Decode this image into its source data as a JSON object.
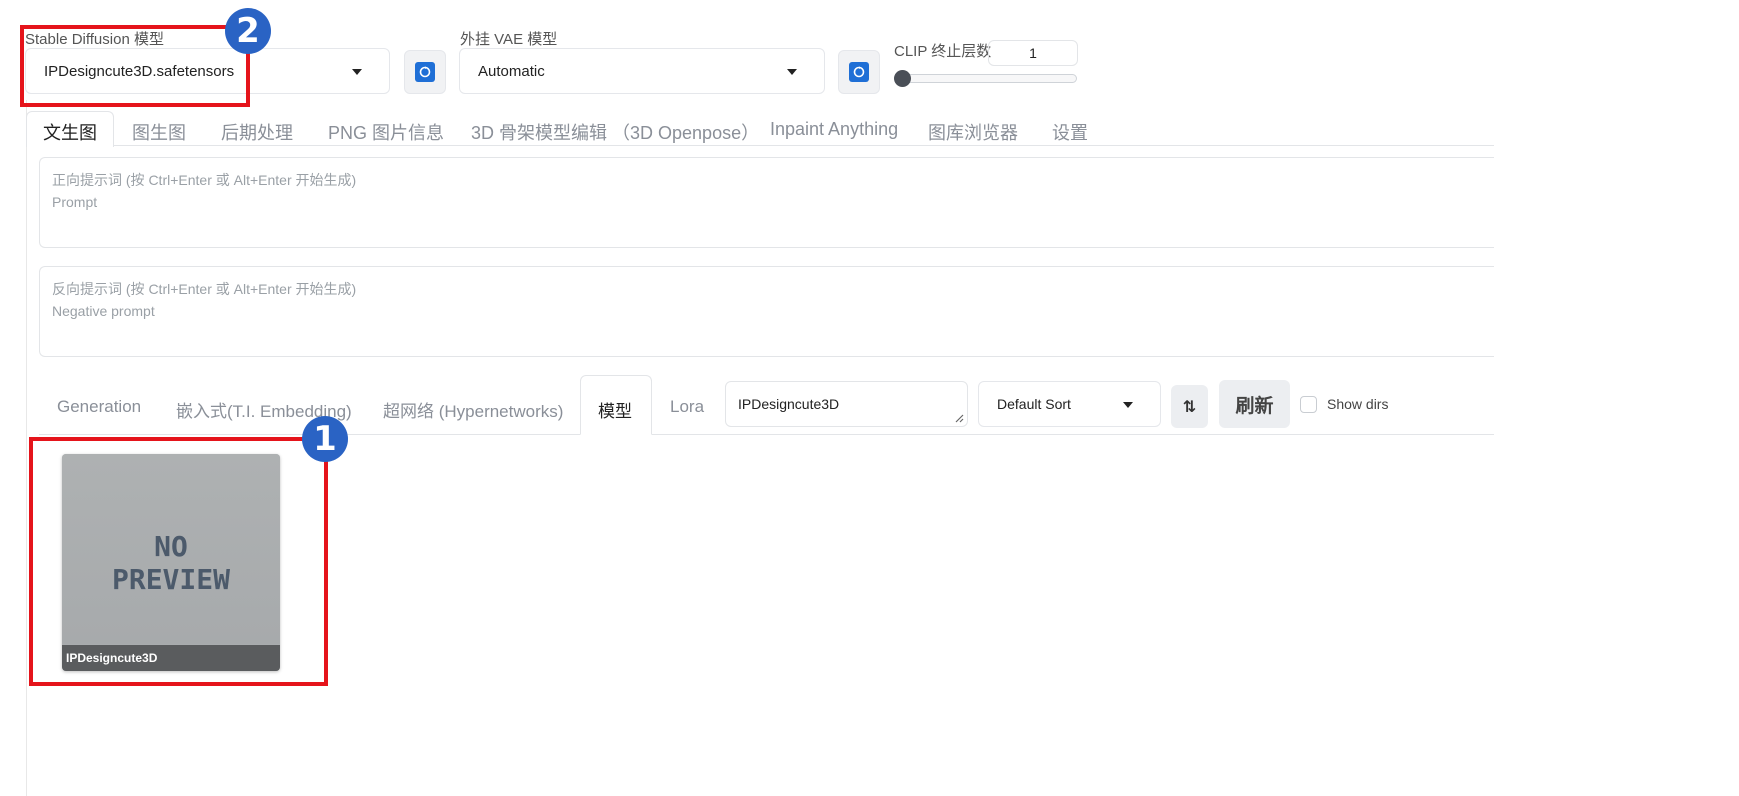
{
  "top": {
    "sd_model_label": "Stable Diffusion 模型",
    "sd_model_value": "IPDesigncute3D.safetensors",
    "vae_label": "外挂 VAE 模型",
    "vae_value": "Automatic",
    "clip_label": "CLIP 终止层数",
    "clip_value": "1",
    "clip_slider_level": 0
  },
  "main_tabs": [
    {
      "label": "文生图"
    },
    {
      "label": "图生图"
    },
    {
      "label": "后期处理"
    },
    {
      "label": "PNG 图片信息"
    },
    {
      "label": "3D 骨架模型编辑 （3D Openpose）"
    },
    {
      "label": "Inpaint Anything"
    },
    {
      "label": "图库浏览器"
    },
    {
      "label": "设置"
    }
  ],
  "prompt": {
    "line1": "正向提示词 (按 Ctrl+Enter 或 Alt+Enter 开始生成)",
    "line2": "Prompt"
  },
  "negative_prompt": {
    "line1": "反向提示词 (按 Ctrl+Enter 或 Alt+Enter 开始生成)",
    "line2": "Negative prompt"
  },
  "sub_tabs": [
    {
      "label": "Generation"
    },
    {
      "label": "嵌入式(T.I. Embedding)"
    },
    {
      "label": "超网络 (Hypernetworks)"
    },
    {
      "label": "模型"
    },
    {
      "label": "Lora"
    }
  ],
  "filter": {
    "search_value": "IPDesigncute3D",
    "sort_value": "Default Sort",
    "refresh_label": "刷新",
    "show_dirs_label": "Show dirs"
  },
  "card": {
    "preview_line1": "NO",
    "preview_line2": "PREVIEW",
    "name": "IPDesigncute3D"
  },
  "markers": {
    "one": "1",
    "two": "2"
  },
  "colors": {
    "annotation_red": "#e5141b",
    "marker_blue": "#2a63c4",
    "refresh_blue": "#1f6fd6"
  }
}
